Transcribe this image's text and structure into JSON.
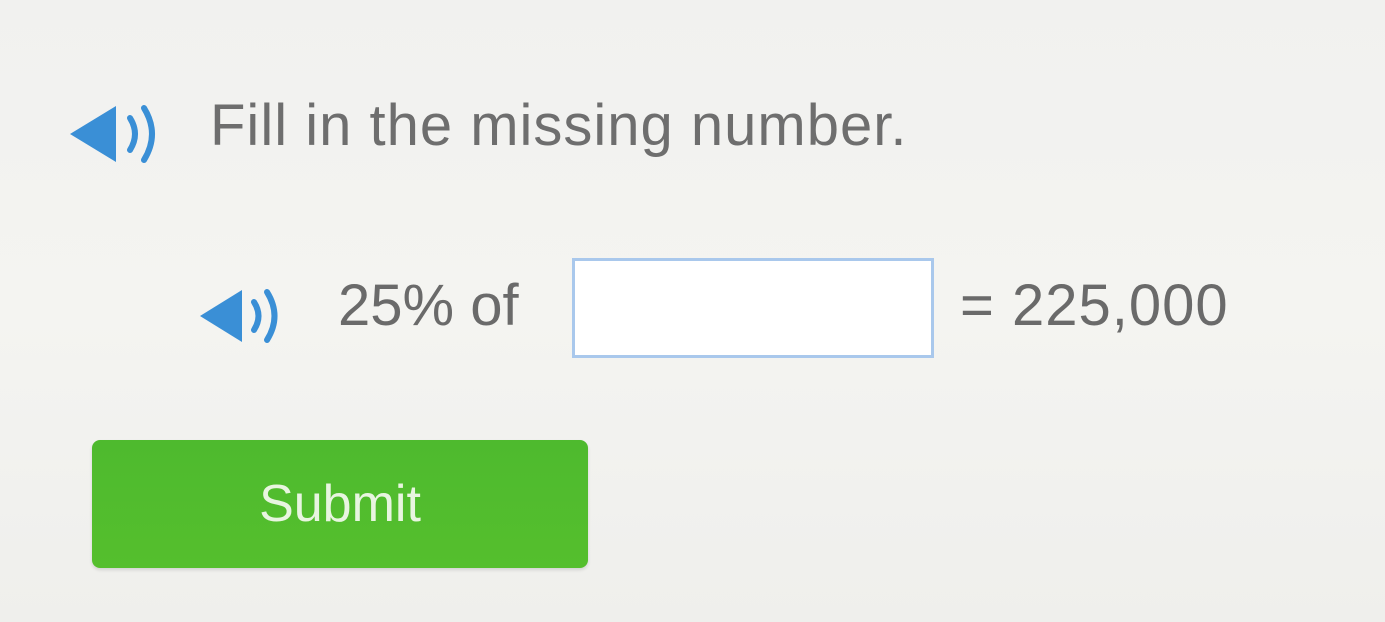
{
  "question": {
    "prompt": "Fill in the missing number."
  },
  "equation": {
    "lead_text": "25% of",
    "answer_value": "",
    "tail_text": "= 225,000"
  },
  "actions": {
    "submit_label": "Submit"
  },
  "icons": {
    "audio": "speaker-icon"
  },
  "colors": {
    "speaker_blue": "#3a8fd6",
    "submit_green": "#52bd2d",
    "input_border": "#a9c8ec"
  }
}
